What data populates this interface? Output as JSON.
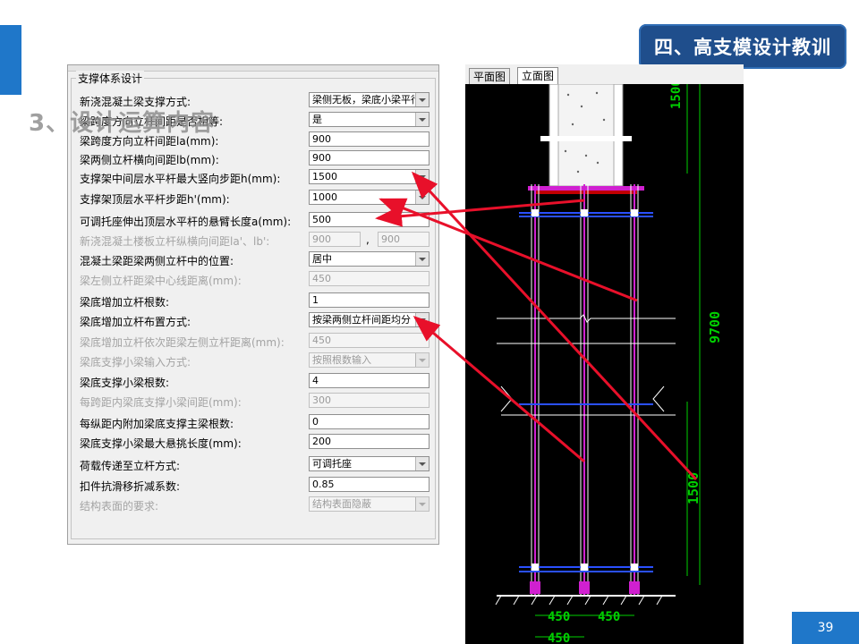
{
  "header": {
    "badge": "四、高支模设计教训"
  },
  "overlay": {
    "section_title": "3、设计运算内容"
  },
  "dialog": {
    "group_title": "支撑体系设计",
    "rows": [
      {
        "label": "新浇混凝土梁支撑方式:",
        "type": "select",
        "value": "梁侧无板，梁底小梁平行梁跨方向",
        "disabled": false
      },
      {
        "label": "梁跨度方向立杆间距是否相等:",
        "type": "select",
        "value": "是",
        "disabled": false
      },
      {
        "label": "梁跨度方向立杆间距la(mm):",
        "type": "input",
        "value": "900",
        "disabled": false
      },
      {
        "label": "梁两侧立杆横向间距lb(mm):",
        "type": "input",
        "value": "900",
        "disabled": false
      },
      {
        "label": "支撑架中间层水平杆最大竖向步距h(mm):",
        "type": "select",
        "value": "1500",
        "disabled": false
      },
      {
        "label": "支撑架顶层水平杆步距h'(mm):",
        "type": "select",
        "value": "1000",
        "disabled": false
      },
      {
        "label": "可调托座伸出顶层水平杆的悬臂长度a(mm):",
        "type": "input",
        "value": "500",
        "disabled": false
      },
      {
        "label": "新浇混凝土楼板立杆纵横向间距la'、lb':",
        "type": "split",
        "value": "900",
        "value2": "900",
        "separator": ",",
        "disabled": true
      },
      {
        "label": "混凝土梁距梁两侧立杆中的位置:",
        "type": "select",
        "value": "居中",
        "disabled": false
      },
      {
        "label": "梁左侧立杆距梁中心线距离(mm):",
        "type": "input",
        "value": "450",
        "disabled": true
      },
      {
        "label": "梁底增加立杆根数:",
        "type": "input",
        "value": "1",
        "disabled": false
      },
      {
        "label": "梁底增加立杆布置方式:",
        "type": "select",
        "value": "按梁两侧立杆间距均分",
        "disabled": false
      },
      {
        "label": "梁底增加立杆依次距梁左侧立杆距离(mm):",
        "type": "input",
        "value": "450",
        "disabled": true
      },
      {
        "label": "梁底支撑小梁输入方式:",
        "type": "select",
        "value": "按照根数输入",
        "disabled": true
      },
      {
        "label": "梁底支撑小梁根数:",
        "type": "input",
        "value": "4",
        "disabled": false
      },
      {
        "label": "每跨距内梁底支撑小梁间距(mm):",
        "type": "input",
        "value": "300",
        "disabled": true
      },
      {
        "label": "每纵距内附加梁底支撑主梁根数:",
        "type": "input",
        "value": "0",
        "disabled": false
      },
      {
        "label": "梁底支撑小梁最大悬挑长度(mm):",
        "type": "input",
        "value": "200",
        "disabled": false
      },
      {
        "label": "荷载传递至立杆方式:",
        "type": "select",
        "value": "可调托座",
        "disabled": false
      },
      {
        "label": "扣件抗滑移折减系数:",
        "type": "input",
        "value": "0.85",
        "disabled": false
      },
      {
        "label": "结构表面的要求:",
        "type": "select",
        "value": "结构表面隐蔽",
        "disabled": true
      }
    ]
  },
  "cad": {
    "tabs": [
      "平面图",
      "立面图"
    ],
    "active_tab": "立面图",
    "dim_top": "1500",
    "dim_total": "9700",
    "dim_bottom": "1500",
    "dim_spacing_left": "450",
    "dim_spacing_right": "450",
    "dim_beam_width": "450"
  },
  "footer": {
    "page_number": "39"
  },
  "colors": {
    "accent": "#1f77c9",
    "badge_bg": "#1f4e8c",
    "annotation_arrow": "#e8102a",
    "cad_dimension": "#00d000"
  }
}
